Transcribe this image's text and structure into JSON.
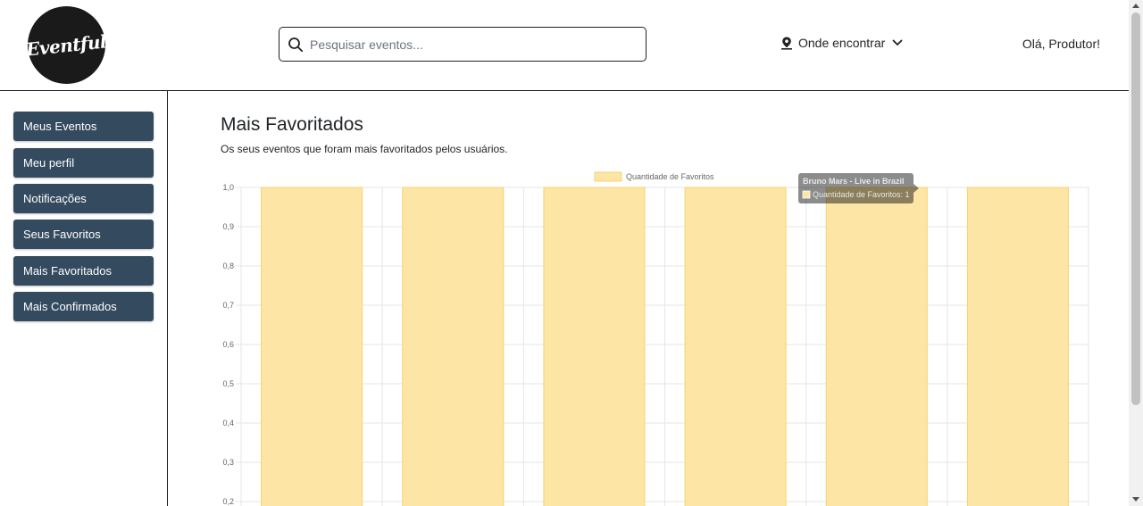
{
  "header": {
    "logo_text": "Eventful",
    "search_placeholder": "Pesquisar eventos...",
    "location_label": "Onde encontrar",
    "greeting": "Olá, Produtor!"
  },
  "sidebar": {
    "items": [
      {
        "label": "Meus Eventos"
      },
      {
        "label": "Meu perfil"
      },
      {
        "label": "Notificações"
      },
      {
        "label": "Seus Favoritos"
      },
      {
        "label": "Mais Favoritados"
      },
      {
        "label": "Mais Confirmados"
      }
    ]
  },
  "main": {
    "title": "Mais Favoritados",
    "subtitle": "Os seus eventos que foram mais favoritados pelos usuários."
  },
  "tooltip": {
    "title": "Bruno Mars - Live in Brazil",
    "label": "Quantidade de Favoritos: 1"
  },
  "chart_data": {
    "type": "bar",
    "series": [
      {
        "name": "Quantidade de Favoritos",
        "values": [
          1,
          1,
          1,
          1,
          1,
          1
        ]
      }
    ],
    "y_ticks": [
      "1,0",
      "0,9",
      "0,8",
      "0,7",
      "0,6",
      "0,5",
      "0,4",
      "0,3",
      "0,2"
    ],
    "ylim": [
      0,
      1
    ],
    "grid": true,
    "legend": "top",
    "colors": {
      "bar_fill": "#fde5a5",
      "bar_border": "#f6d46f",
      "grid": "#e6e6e6"
    }
  }
}
